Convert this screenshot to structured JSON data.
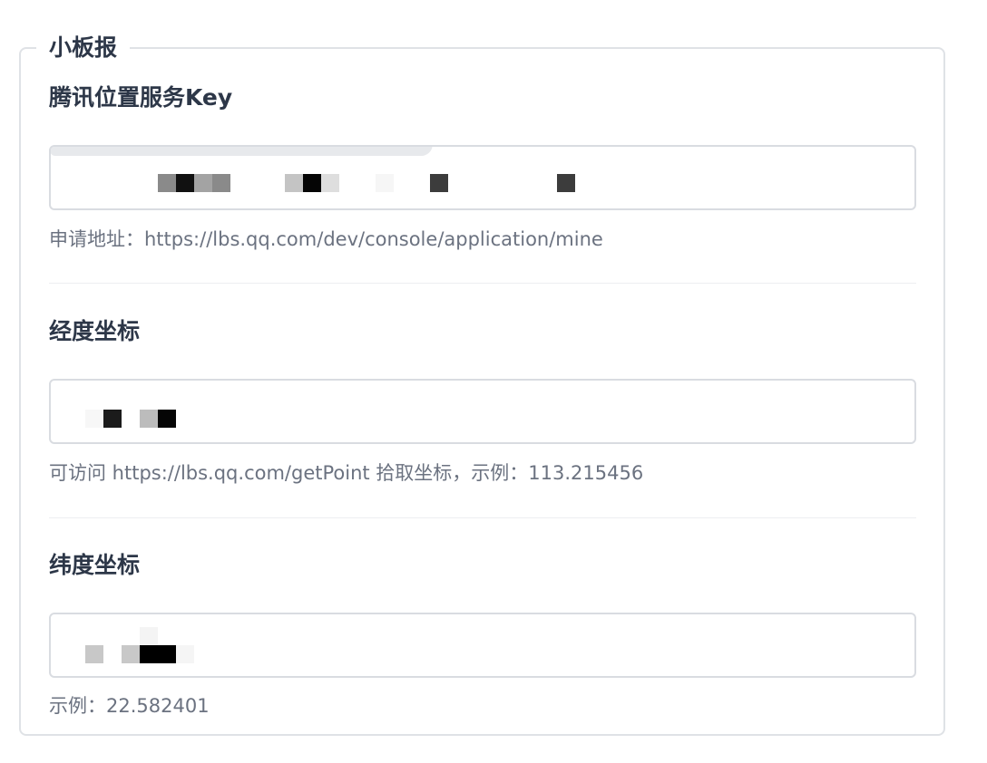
{
  "panel": {
    "legend": "小板报"
  },
  "fields": [
    {
      "label": "腾讯位置服务Key",
      "hint": "申请地址：https://lbs.qq.com/dev/console/application/mine"
    },
    {
      "label": "经度坐标",
      "hint": "可访问 https://lbs.qq.com/getPoint 拾取坐标，示例：113.215456"
    },
    {
      "label": "纬度坐标",
      "hint": "示例：22.582401"
    }
  ]
}
